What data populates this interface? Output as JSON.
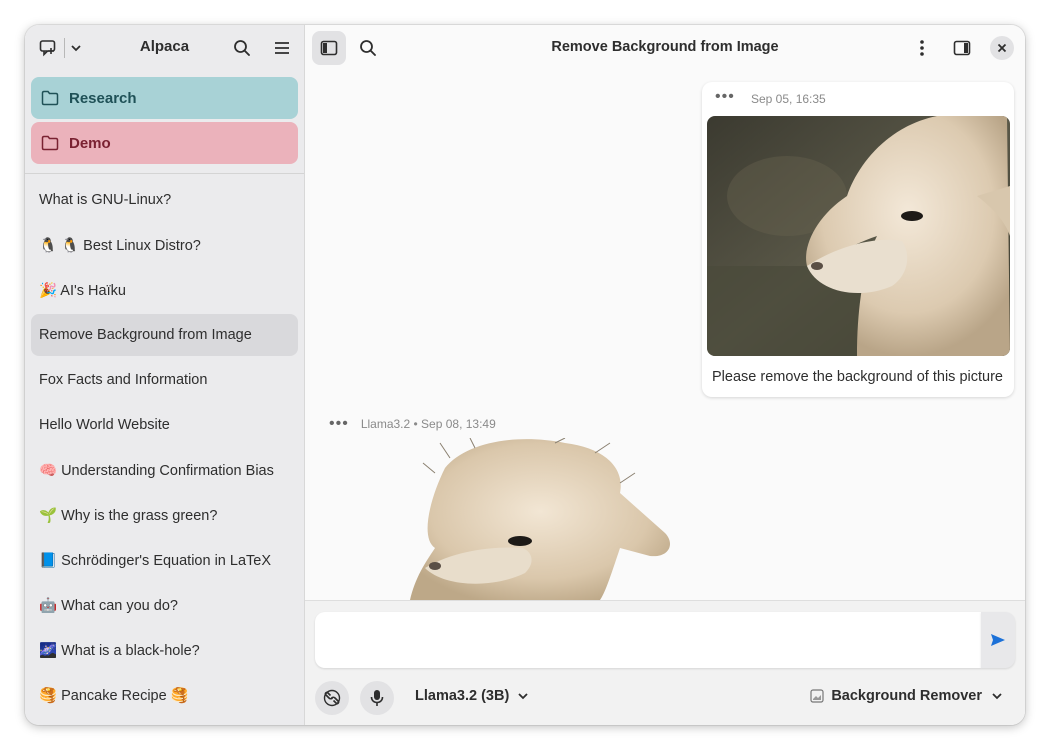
{
  "sidebar": {
    "title": "Alpaca",
    "folders": [
      {
        "label": "Research",
        "bg": "#a8d2d6",
        "fg": "#1f5157"
      },
      {
        "label": "Demo",
        "bg": "#ebb2bb",
        "fg": "#7a2232"
      }
    ],
    "chats": [
      {
        "label": "What is GNU-Linux?"
      },
      {
        "label": "🐧 🐧 Best Linux Distro?"
      },
      {
        "label": "🎉 AI's Haïku"
      },
      {
        "label": "Remove Background from Image"
      },
      {
        "label": "Fox Facts and Information"
      },
      {
        "label": "Hello World Website"
      },
      {
        "label": "🧠 Understanding Confirmation Bias"
      },
      {
        "label": "🌱 Why is the grass green?"
      },
      {
        "label": "📘 Schrödinger's Equation in LaTeX"
      },
      {
        "label": "🤖 What can you do?"
      },
      {
        "label": "🌌 What is a black-hole?"
      },
      {
        "label": "🥞 Pancake Recipe 🥞"
      }
    ],
    "active_chat_index": 3
  },
  "main": {
    "title": "Remove Background from Image",
    "user_message": {
      "timestamp": "Sep 05, 16:35",
      "text": "Please remove the background of this picture"
    },
    "bot_message": {
      "meta": "Llama3.2 • Sep 08, 13:49"
    }
  },
  "input": {
    "model": "Llama3.2 (3B)",
    "tool": "Background Remover"
  },
  "colors": {
    "accent": "#1c71d8"
  }
}
